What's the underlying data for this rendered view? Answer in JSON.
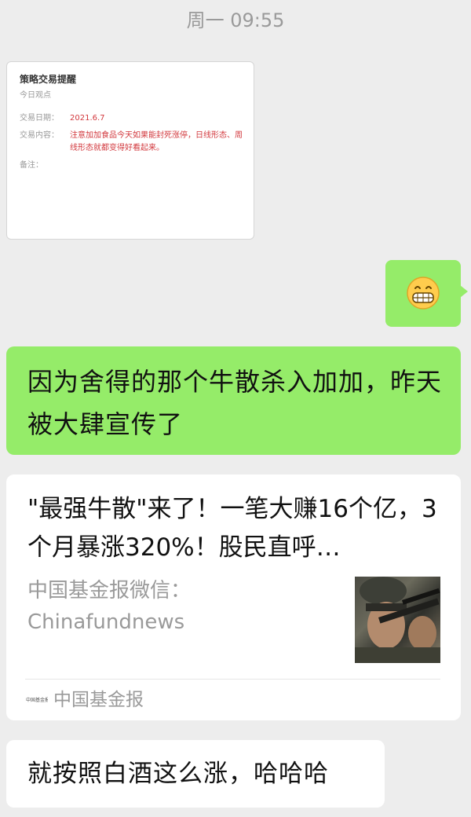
{
  "timestamp": "周一 09:55",
  "note_card": {
    "title": "策略交易提醒",
    "subtitle": "今日观点",
    "date_label": "交易日期：",
    "date_value": "2021.6.7",
    "content_label": "交易内容：",
    "content_value": "注意加加食品今天如果能封死涨停，日线形态、周线形态就都变得好看起来。",
    "note_label": "备注：",
    "note_value": ""
  },
  "emoji_message": {
    "icon": "grinning-face-icon"
  },
  "message_green": {
    "text": "因为舍得的那个牛散杀入加加，昨天被大肆宣传了"
  },
  "link_card": {
    "title": "\"最强牛散\"来了！一笔大赚16个亿，3个月暴涨320%！股民直呼…",
    "description": "中国基金报微信：Chinafundnews",
    "thumbnail_icon": "soldier-photo",
    "source_name": "中国基金报"
  },
  "message_white": {
    "text": "就按照白酒这么涨，哈哈哈"
  },
  "colors": {
    "background": "#ededed",
    "bubble_green": "#95ec69",
    "bubble_white": "#ffffff",
    "note_red": "#d2383d",
    "meta_gray": "#9a9a9a"
  }
}
